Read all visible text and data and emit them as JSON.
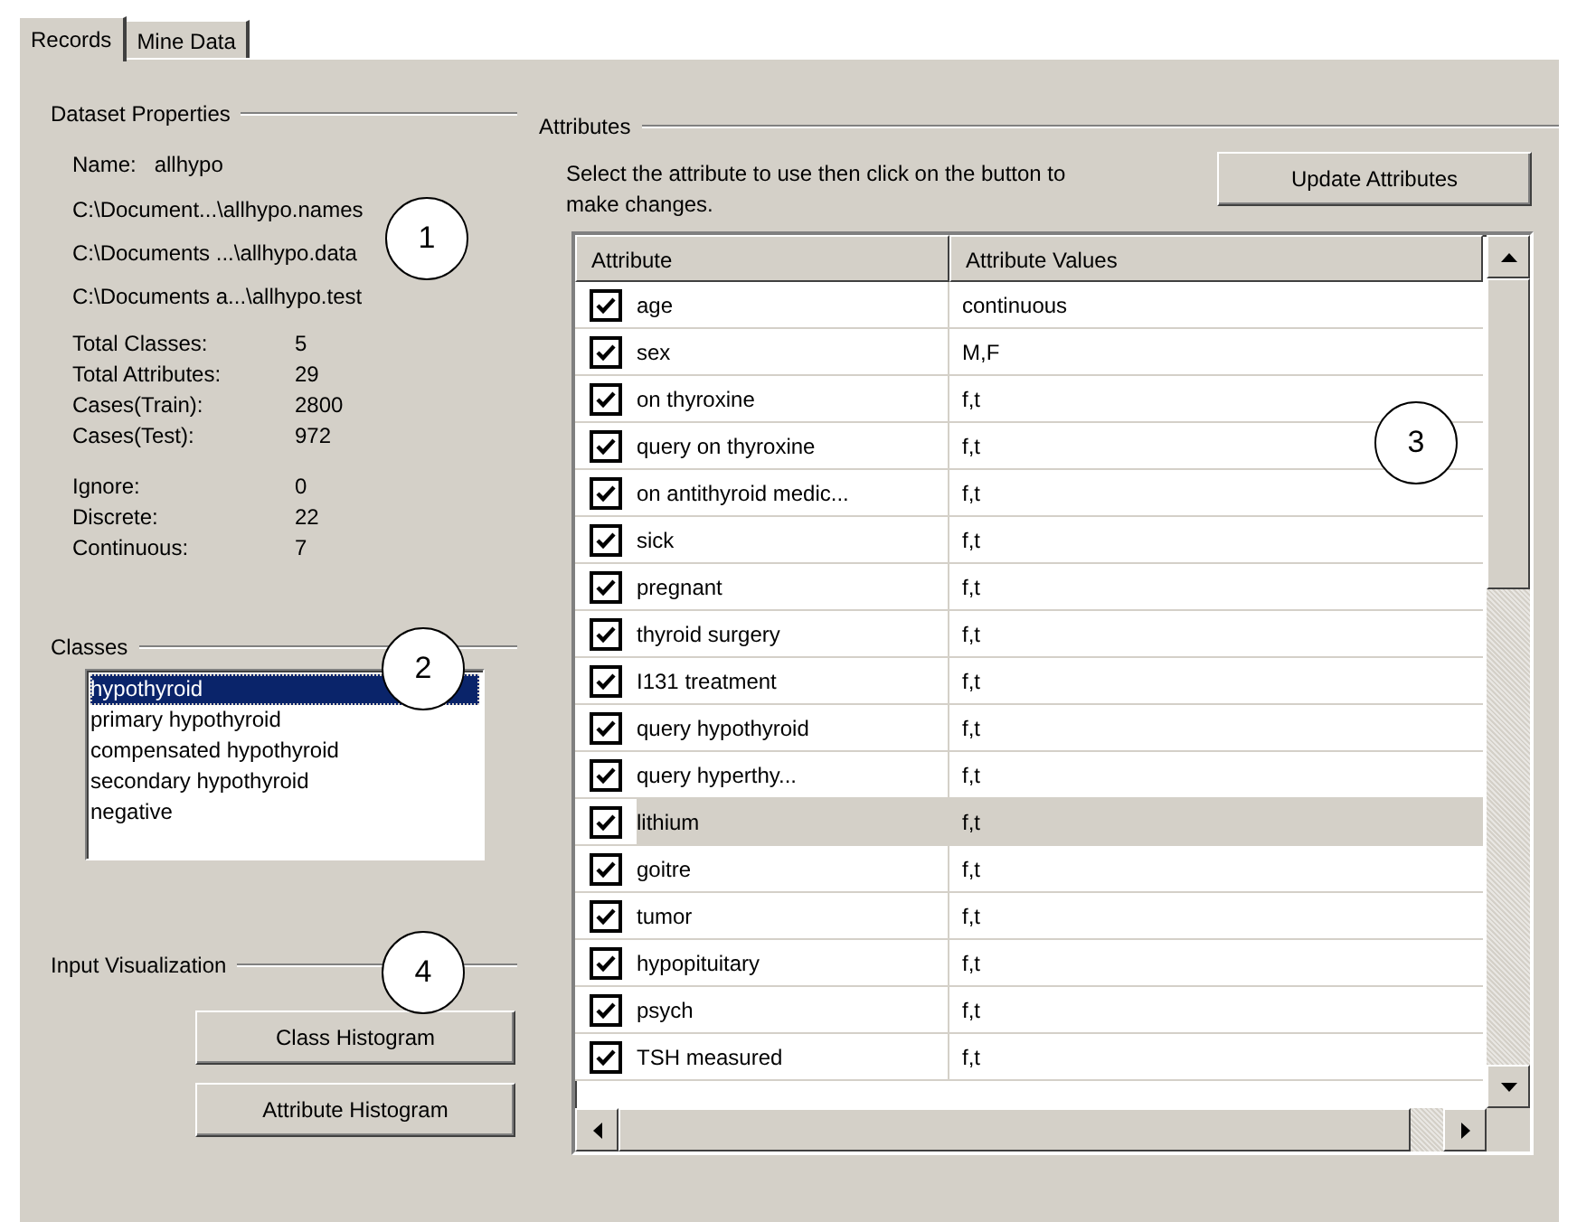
{
  "tabs": [
    {
      "label": "Records",
      "selected": true
    },
    {
      "label": "Mine Data",
      "selected": false
    }
  ],
  "dataset_properties": {
    "title": "Dataset Properties",
    "callout": "1",
    "name_label": "Name:",
    "name_value": "allhypo",
    "paths": [
      "C:\\Document...\\allhypo.names",
      "C:\\Documents ...\\allhypo.data",
      "C:\\Documents a...\\allhypo.test"
    ],
    "stat_groups": [
      [
        {
          "label": "Total Classes:",
          "value": "5"
        },
        {
          "label": "Total Attributes:",
          "value": "29"
        },
        {
          "label": "Cases(Train):",
          "value": "2800"
        },
        {
          "label": "Cases(Test):",
          "value": "972"
        }
      ],
      [
        {
          "label": "Ignore:",
          "value": "0"
        },
        {
          "label": "Discrete:",
          "value": "22"
        },
        {
          "label": "Continuous:",
          "value": "7"
        }
      ]
    ]
  },
  "classes": {
    "title": "Classes",
    "callout": "2",
    "items": [
      {
        "label": "hypothyroid",
        "selected": true
      },
      {
        "label": "primary hypothyroid",
        "selected": false
      },
      {
        "label": "compensated hypothyroid",
        "selected": false
      },
      {
        "label": "secondary hypothyroid",
        "selected": false
      },
      {
        "label": "negative",
        "selected": false
      }
    ]
  },
  "input_visualization": {
    "title": "Input Visualization",
    "callout": "4",
    "buttons": [
      "Class Histogram",
      "Attribute Histogram"
    ]
  },
  "attributes": {
    "title": "Attributes",
    "callout": "3",
    "instruction": "Select the attribute to use then click on the button to make changes.",
    "update_button": "Update Attributes",
    "columns": [
      "Attribute",
      "Attribute Values"
    ],
    "rows": [
      {
        "attribute": "age",
        "values": "continuous",
        "checked": true,
        "selected": false
      },
      {
        "attribute": "sex",
        "values": "M,F",
        "checked": true,
        "selected": false
      },
      {
        "attribute": "on thyroxine",
        "values": "f,t",
        "checked": true,
        "selected": false
      },
      {
        "attribute": "query on thyroxine",
        "values": "f,t",
        "checked": true,
        "selected": false
      },
      {
        "attribute": "on antithyroid medic...",
        "values": "f,t",
        "checked": true,
        "selected": false
      },
      {
        "attribute": "sick",
        "values": "f,t",
        "checked": true,
        "selected": false
      },
      {
        "attribute": "pregnant",
        "values": "f,t",
        "checked": true,
        "selected": false
      },
      {
        "attribute": "thyroid surgery",
        "values": "f,t",
        "checked": true,
        "selected": false
      },
      {
        "attribute": "I131 treatment",
        "values": "f,t",
        "checked": true,
        "selected": false
      },
      {
        "attribute": "query hypothyroid",
        "values": "f,t",
        "checked": true,
        "selected": false
      },
      {
        "attribute": "query hyperthy...",
        "values": "f,t",
        "checked": true,
        "selected": false
      },
      {
        "attribute": "lithium",
        "values": "f,t",
        "checked": true,
        "selected": true
      },
      {
        "attribute": "goitre",
        "values": "f,t",
        "checked": true,
        "selected": false
      },
      {
        "attribute": "tumor",
        "values": "f,t",
        "checked": true,
        "selected": false
      },
      {
        "attribute": "hypopituitary",
        "values": "f,t",
        "checked": true,
        "selected": false
      },
      {
        "attribute": "psych",
        "values": "f,t",
        "checked": true,
        "selected": false
      },
      {
        "attribute": "TSH measured",
        "values": "f,t",
        "checked": true,
        "selected": false
      }
    ]
  }
}
